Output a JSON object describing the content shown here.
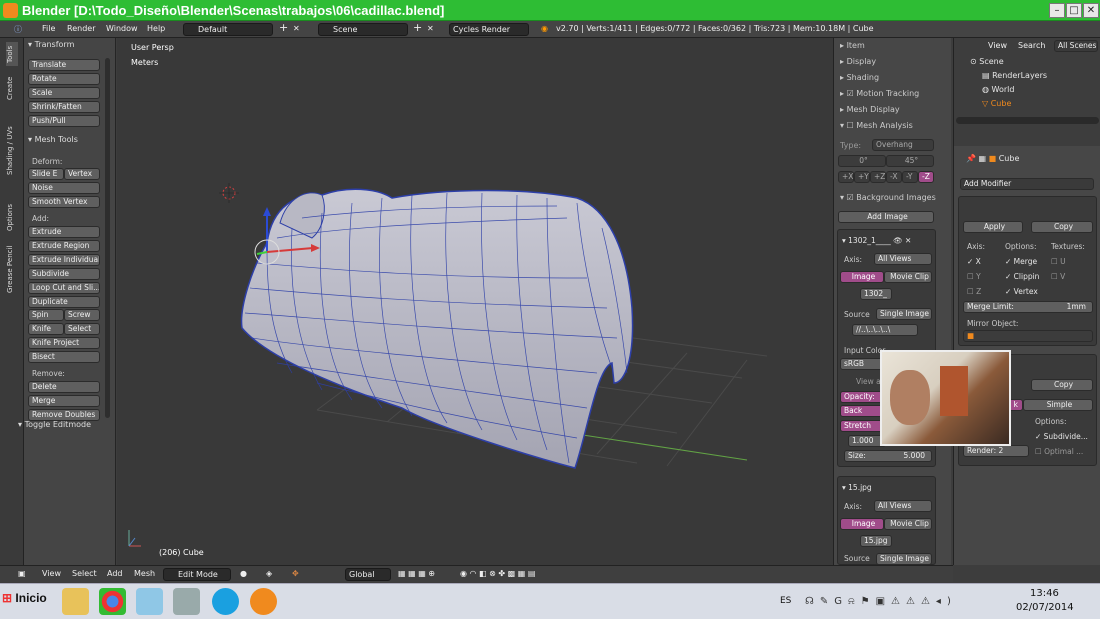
{
  "window": {
    "title": "Blender [D:\\Todo_Diseño\\Blender\\Scenas\\trabajos\\06\\cadillac.blend]"
  },
  "info_header": {
    "menus": [
      "File",
      "Render",
      "Window",
      "Help"
    ],
    "screen_layout": "Default",
    "scene": "Scene",
    "render_engine": "Cycles Render",
    "stats": "v2.70 | Verts:1/411 | Edges:0/772 | Faces:0/362 | Tris:723 | Mem:10.18M | Cube"
  },
  "tool_tabs": [
    "Tools",
    "Create",
    "Shading / UVs",
    "Options",
    "Grease Pencil"
  ],
  "tool_shelf": {
    "transform_header": "Transform",
    "transform": [
      "Translate",
      "Rotate",
      "Scale",
      "Shrink/Fatten",
      "Push/Pull"
    ],
    "mesh_tools_header": "Mesh Tools",
    "deform_label": "Deform:",
    "deform": [
      "Slide E",
      "Vertex",
      "Noise",
      "Smooth Vertex"
    ],
    "add_label": "Add:",
    "add": [
      "Extrude",
      "Extrude Region",
      "Extrude Individual",
      "Subdivide",
      "Loop Cut and Sli...",
      "Duplicate",
      "Spin",
      "Screw",
      "Knife",
      "Select",
      "Knife Project",
      "Bisect"
    ],
    "remove_label": "Remove:",
    "remove": [
      "Delete",
      "Merge",
      "Remove Doubles"
    ],
    "toggle_editmode": "Toggle Editmode"
  },
  "viewport": {
    "view_name": "User Persp",
    "units": "Meters",
    "object_label": "(206) Cube"
  },
  "n_panel": {
    "sections": [
      "Item",
      "Display",
      "Shading",
      "Motion Tracking",
      "Mesh Display",
      "Mesh Analysis"
    ],
    "type_label": "Type:",
    "type_value": "Overhang",
    "angle_min": "0°",
    "angle_max": "45°",
    "axes": [
      "+X",
      "+Y",
      "+Z",
      "-X",
      "-Y",
      "-Z"
    ],
    "bg_images_label": "Background Images",
    "add_image": "Add Image",
    "image1": {
      "name": "1302_1____",
      "axis_label": "Axis:",
      "axis_value": "All Views",
      "tab_image": "Image",
      "tab_movie": "Movie Clip",
      "file": "1302_",
      "source_label": "Source",
      "source_value": "Single Image",
      "path": "//..\\..\\..\\..\\",
      "input_color_label": "Input Color",
      "color_space": "sRGB",
      "view_as_label": "View as",
      "opacity_label": "Opacity:",
      "back_label": "Back",
      "stretch_label": "Stretch",
      "x_label": "1.000",
      "size_label": "Size:",
      "size_value": "5.000"
    },
    "image2": {
      "name": "15.jpg",
      "axis_label": "Axis:",
      "axis_value": "All Views",
      "tab_image": "Image",
      "tab_movie": "Movie Clip",
      "file": "15.jpg",
      "source_label": "Source",
      "source_value": "Single Image"
    }
  },
  "outliner": {
    "menus": [
      "View",
      "Search"
    ],
    "filter": "All Scenes",
    "items": [
      "Scene",
      "RenderLayers",
      "World",
      "Cube"
    ]
  },
  "properties": {
    "object_name": "Cube",
    "add_modifier": "Add Modifier",
    "mirror": {
      "apply": "Apply",
      "copy": "Copy",
      "axis_label": "Axis:",
      "options_label": "Options:",
      "textures_label": "Textures:",
      "axes": [
        "X",
        "Y",
        "Z"
      ],
      "options": [
        "Merge",
        "Clippin",
        "Vertex"
      ],
      "textures": [
        "U",
        "V"
      ],
      "merge_limit_label": "Merge Limit:",
      "merge_limit_value": "1mm",
      "mirror_object_label": "Mirror Object:"
    },
    "subsurf": {
      "copy": "Copy",
      "catmull_label": "k",
      "simple": "Simple",
      "options_label": "Options:",
      "subdivide": "Subdivide...",
      "optimal": "Optimal ...",
      "render_label": "Render:",
      "render_value": "2"
    }
  },
  "bottom_header": {
    "menus": [
      "View",
      "Select",
      "Add",
      "Mesh"
    ],
    "mode": "Edit Mode",
    "orientation": "Global"
  },
  "taskbar": {
    "start": "Inicio",
    "lang": "ES",
    "time": "13:46",
    "date": "02/07/2014"
  },
  "colors": {
    "title_bar": "#2ebd34",
    "accent_pink": "#a04c8a",
    "mesh_wire": "#2d3fa8",
    "cube_orange": "#f08a1e"
  }
}
